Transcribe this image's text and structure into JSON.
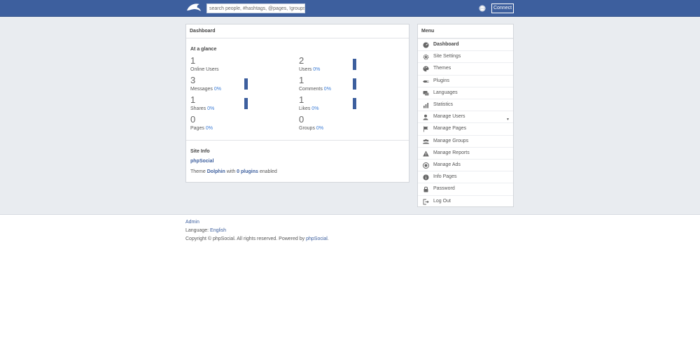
{
  "header": {
    "search_placeholder": "search people, #hashtags, @pages, !groups",
    "connect_label": "Connect"
  },
  "dashboard": {
    "title": "Dashboard",
    "glance_title": "At a glance",
    "stats": [
      {
        "num": "1",
        "label": "Online Users",
        "pct": "",
        "bar": false
      },
      {
        "num": "2",
        "label": "Users",
        "pct": "0%",
        "bar": true
      },
      {
        "num": "3",
        "label": "Messages",
        "pct": "0%",
        "bar": true
      },
      {
        "num": "1",
        "label": "Comments",
        "pct": "0%",
        "bar": true
      },
      {
        "num": "1",
        "label": "Shares",
        "pct": "0%",
        "bar": true
      },
      {
        "num": "1",
        "label": "Likes",
        "pct": "0%",
        "bar": true
      },
      {
        "num": "0",
        "label": "Pages",
        "pct": "0%",
        "bar": false
      },
      {
        "num": "0",
        "label": "Groups",
        "pct": "0%",
        "bar": false
      }
    ],
    "site_info": {
      "title": "Site Info",
      "name": "phpSocial",
      "theme_prefix": "Theme",
      "theme_name": "Dolphin",
      "theme_mid": "with",
      "plugins": "0 plugins",
      "theme_suffix": "enabled"
    }
  },
  "menu": {
    "title": "Menu",
    "items": [
      {
        "label": "Dashboard",
        "icon": "dashboard-icon",
        "active": true
      },
      {
        "label": "Site Settings",
        "icon": "gear-icon"
      },
      {
        "label": "Themes",
        "icon": "palette-icon"
      },
      {
        "label": "Plugins",
        "icon": "plug-icon"
      },
      {
        "label": "Languages",
        "icon": "chat-icon"
      },
      {
        "label": "Statistics",
        "icon": "bar-chart-icon"
      },
      {
        "label": "Manage Users",
        "icon": "user-icon",
        "caret": true
      },
      {
        "label": "Manage Pages",
        "icon": "flag-icon"
      },
      {
        "label": "Manage Groups",
        "icon": "group-icon"
      },
      {
        "label": "Manage Reports",
        "icon": "warning-icon"
      },
      {
        "label": "Manage Ads",
        "icon": "ads-icon"
      },
      {
        "label": "Info Pages",
        "icon": "info-icon"
      },
      {
        "label": "Password",
        "icon": "lock-icon"
      },
      {
        "label": "Log Out",
        "icon": "logout-icon"
      }
    ]
  },
  "footer": {
    "admin_link": "Admin",
    "language_label": "Language:",
    "language_value": "English",
    "copyright": "Copyright © phpSocial. All rights reserved. Powered by",
    "powered_link": "phpSocial",
    "period": "."
  },
  "colors": {
    "brand": "#3d5f9e",
    "link": "#3a7bd5",
    "band": "#e9ecf0"
  }
}
